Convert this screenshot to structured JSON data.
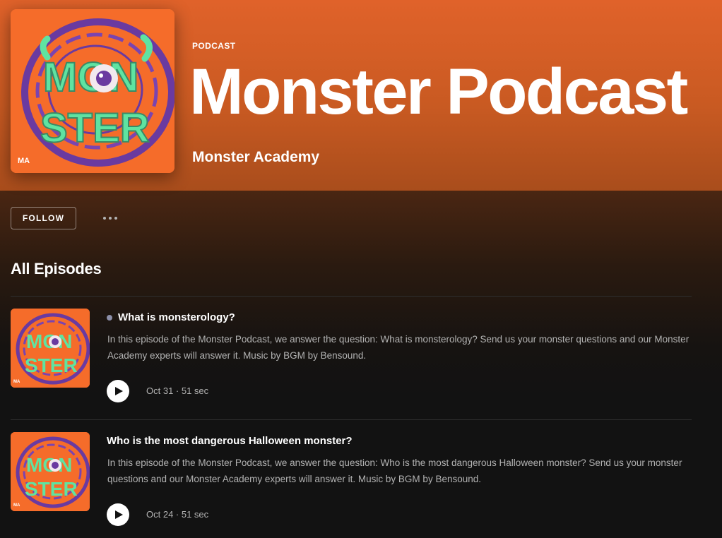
{
  "header": {
    "type_label": "PODCAST",
    "title": "Monster Podcast",
    "publisher": "Monster Academy",
    "cover_art": {
      "lettering_top": "MON",
      "lettering_bottom": "STER",
      "badge": "MA"
    }
  },
  "actions": {
    "follow_label": "FOLLOW",
    "more_icon": "more-horizontal-icon"
  },
  "episodes_section": {
    "title": "All Episodes",
    "episodes": [
      {
        "title": "What is monsterology?",
        "unplayed": true,
        "description": "In this episode of the Monster Podcast, we answer the question: What is monsterology? Send us your monster questions and our Monster Academy experts will answer it. Music by BGM by Bensound.",
        "date": "Oct 31",
        "duration": "51 sec",
        "meta": "Oct 31 · 51 sec"
      },
      {
        "title": "Who is the most dangerous Halloween monster?",
        "unplayed": false,
        "description": "In this episode of the Monster Podcast, we answer the question: Who is the most dangerous Halloween monster? Send us your monster questions and our Monster Academy experts will answer it. Music by BGM by Bensound.",
        "date": "Oct 24",
        "duration": "51 sec",
        "meta": "Oct 24 · 51 sec"
      }
    ]
  },
  "colors": {
    "hero_orange": "#e0622a",
    "cover_orange": "#f56c2a",
    "cover_green": "#5fe3a1",
    "cover_purple": "#6a3aa0",
    "background": "#121212",
    "muted_text": "#b3b3b3",
    "unplayed_dot": "#8c8fa8"
  }
}
